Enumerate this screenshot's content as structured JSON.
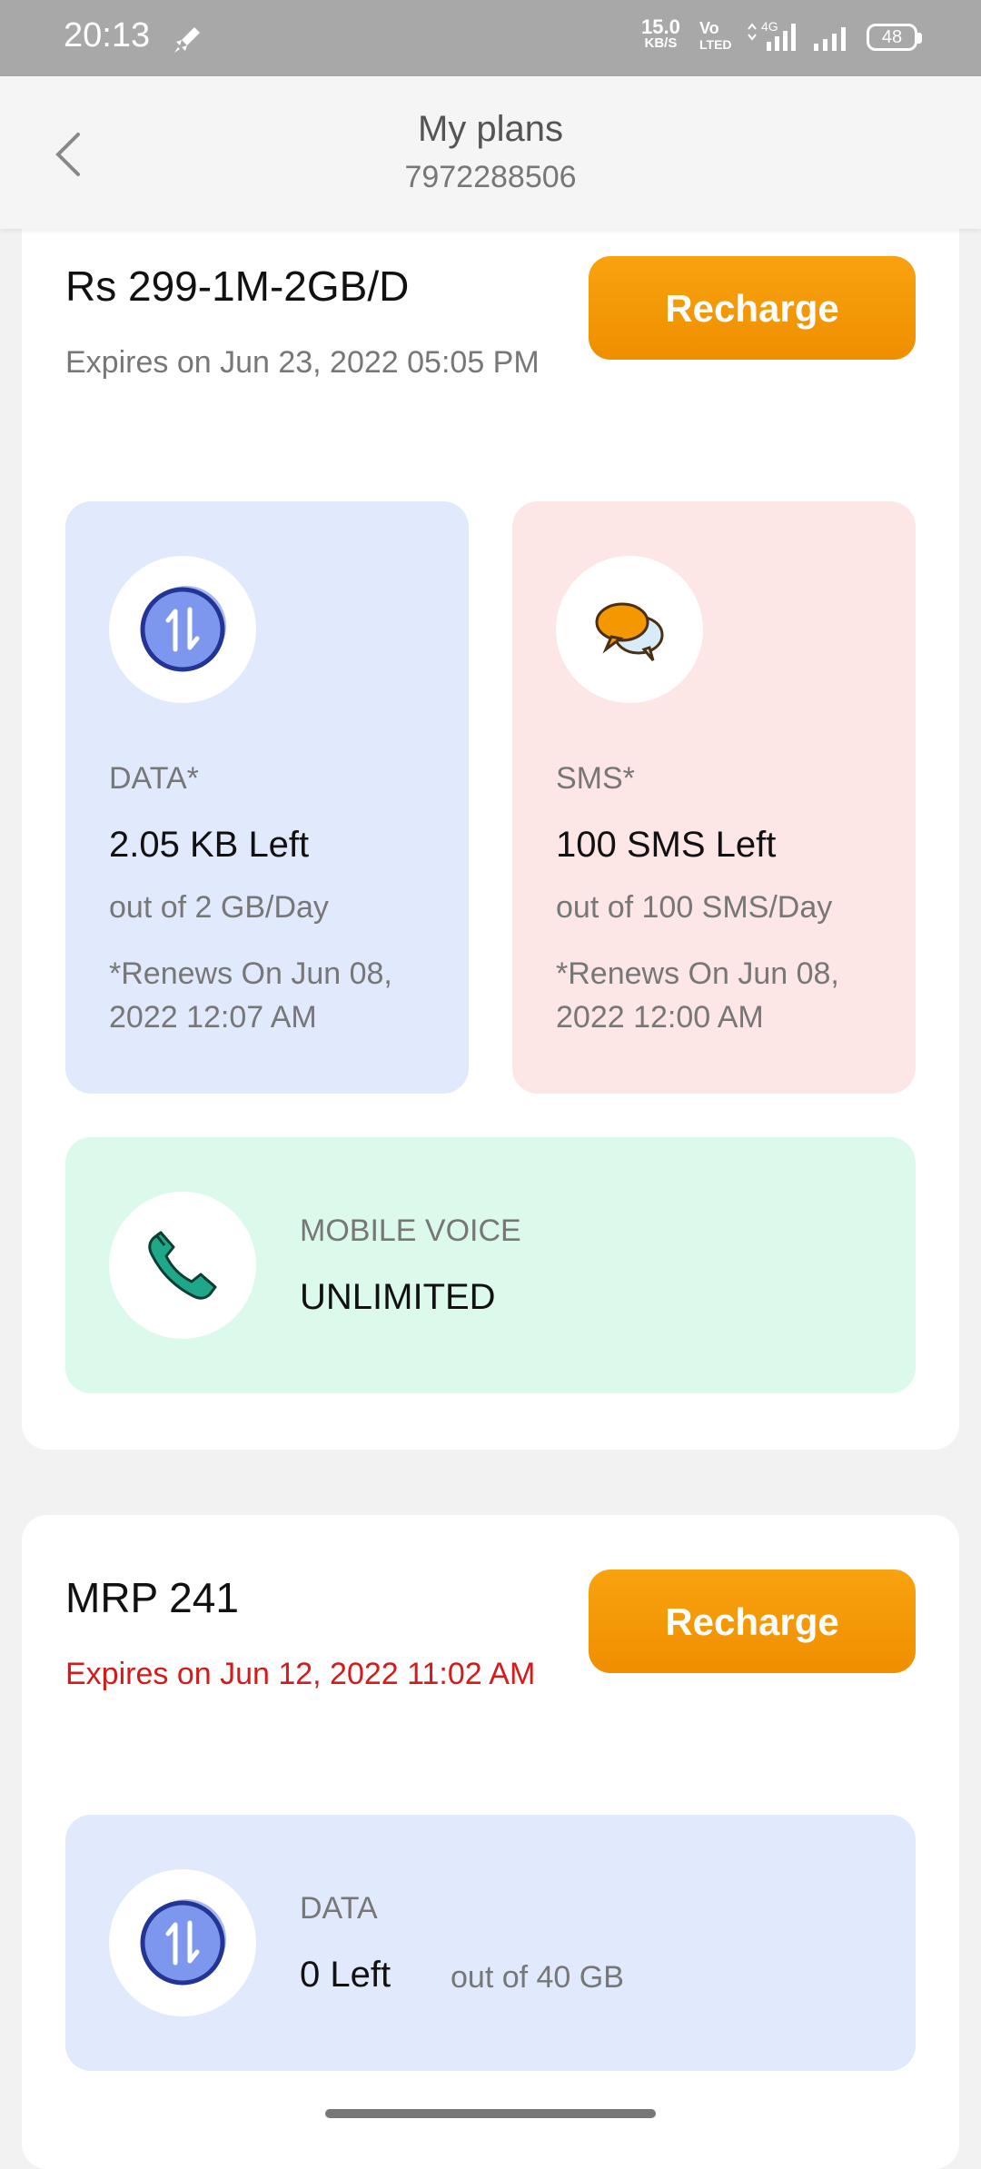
{
  "status_bar": {
    "time": "20:13",
    "net_speed_value": "15.0",
    "net_speed_unit": "KB/S",
    "volte_top": "Vo",
    "volte_bottom": "LTED",
    "network_type": "4G",
    "battery": "48"
  },
  "header": {
    "title": "My plans",
    "phone_number": "7972288506"
  },
  "plans": [
    {
      "name": "Rs 299-1M-2GB/D",
      "expiry": "Expires on Jun 23, 2022 05:05 PM",
      "recharge_label": "Recharge",
      "data": {
        "label": "DATA*",
        "value": "2.05 KB Left",
        "sub": "out of 2 GB/Day",
        "renew": "*Renews On Jun 08, 2022 12:07 AM"
      },
      "sms": {
        "label": "SMS*",
        "value": "100 SMS Left",
        "sub": "out of 100 SMS/Day",
        "renew": "*Renews On Jun 08, 2022 12:00 AM"
      },
      "voice": {
        "label": "MOBILE VOICE",
        "value": "UNLIMITED"
      }
    },
    {
      "name": "MRP 241",
      "expiry": "Expires on Jun 12, 2022 11:02 AM",
      "recharge_label": "Recharge",
      "data": {
        "label": "DATA",
        "value": "0 Left",
        "sub": "out of 40 GB"
      }
    }
  ],
  "icons": {
    "data": "data-transfer-icon",
    "sms": "chat-bubbles-icon",
    "voice": "phone-icon",
    "back": "chevron-left-icon"
  },
  "colors": {
    "accent": "#f39800",
    "expiry_warning": "#d51a1a",
    "data_tile": "#e1eafc",
    "sms_tile": "#fde6e6",
    "voice_tile": "#dcfaec"
  }
}
